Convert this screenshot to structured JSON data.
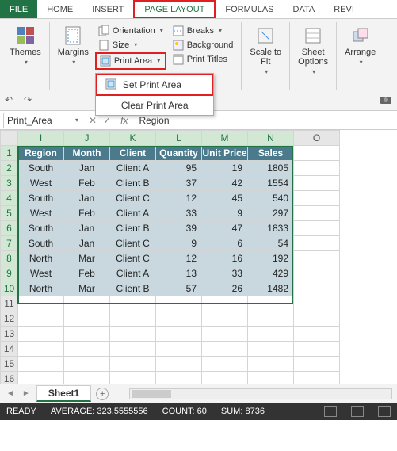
{
  "tabs": {
    "file": "FILE",
    "home": "HOME",
    "insert": "INSERT",
    "pagelayout": "PAGE LAYOUT",
    "formulas": "FORMULAS",
    "data": "DATA",
    "review": "REVI"
  },
  "ribbon": {
    "themes": "Themes",
    "margins": "Margins",
    "orientation": "Orientation",
    "size": "Size",
    "printarea": "Print Area",
    "breaks": "Breaks",
    "background": "Background",
    "printtitles": "Print Titles",
    "scaletofit": "Scale to\nFit",
    "sheetoptions": "Sheet\nOptions",
    "arrange": "Arrange"
  },
  "printarea_menu": {
    "set": "Set Print Area",
    "clear": "Clear Print Area"
  },
  "namebox": "Print_Area",
  "formula": "Region",
  "columns": [
    "I",
    "J",
    "K",
    "L",
    "M",
    "N",
    "O"
  ],
  "selected_cols": [
    0,
    1,
    2,
    3,
    4,
    5
  ],
  "row_count": 16,
  "selected_rows": [
    1,
    2,
    3,
    4,
    5,
    6,
    7,
    8,
    9,
    10
  ],
  "chart_data": {
    "type": "table",
    "headers": [
      "Region",
      "Month",
      "Client",
      "Quantity",
      "Unit Price",
      "Sales"
    ],
    "rows": [
      [
        "South",
        "Jan",
        "Client A",
        95,
        19,
        1805
      ],
      [
        "West",
        "Feb",
        "Client B",
        37,
        42,
        1554
      ],
      [
        "South",
        "Jan",
        "Client C",
        12,
        45,
        540
      ],
      [
        "West",
        "Feb",
        "Client A",
        33,
        9,
        297
      ],
      [
        "South",
        "Jan",
        "Client B",
        39,
        47,
        1833
      ],
      [
        "South",
        "Jan",
        "Client C",
        9,
        6,
        54
      ],
      [
        "North",
        "Mar",
        "Client C",
        12,
        16,
        192
      ],
      [
        "West",
        "Feb",
        "Client A",
        13,
        33,
        429
      ],
      [
        "North",
        "Mar",
        "Client B",
        57,
        26,
        1482
      ]
    ]
  },
  "sheet": "Sheet1",
  "status": {
    "ready": "READY",
    "average_lbl": "AVERAGE:",
    "average": "323.5555556",
    "count_lbl": "COUNT:",
    "count": "60",
    "sum_lbl": "SUM:",
    "sum": "8736"
  }
}
